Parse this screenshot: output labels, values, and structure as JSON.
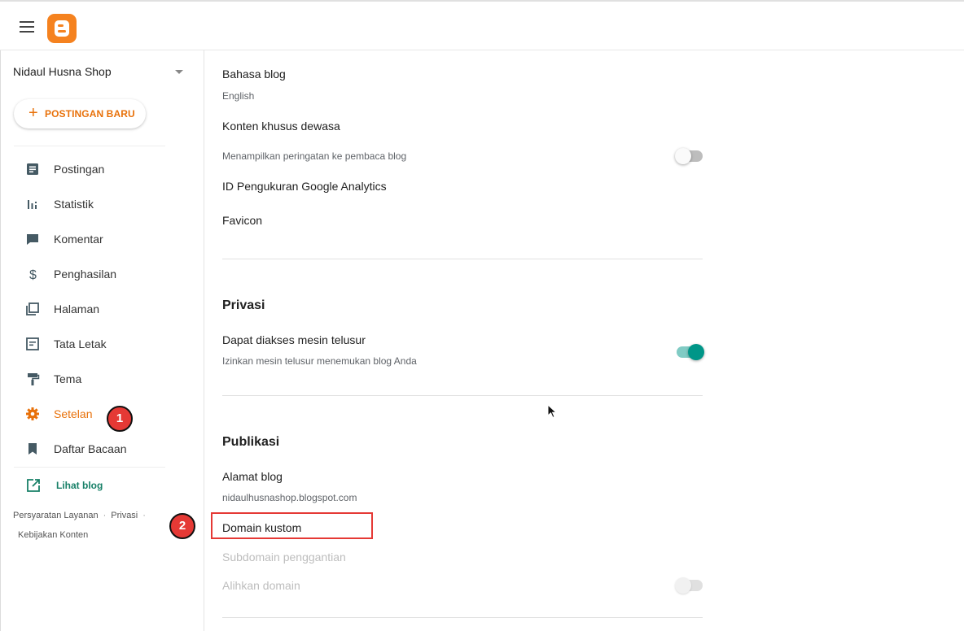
{
  "header": {
    "menu_icon": "hamburger-menu-icon",
    "logo": "blogger-logo"
  },
  "sidebar": {
    "blog_name": "Nidaul Husna Shop",
    "new_post_plus": "+",
    "new_post_label": "POSTINGAN BARU",
    "items": [
      {
        "label": "Postingan",
        "icon": "posts-icon"
      },
      {
        "label": "Statistik",
        "icon": "stats-icon"
      },
      {
        "label": "Komentar",
        "icon": "comment-icon"
      },
      {
        "label": "Penghasilan",
        "icon": "dollar-icon"
      },
      {
        "label": "Halaman",
        "icon": "pages-icon"
      },
      {
        "label": "Tata Letak",
        "icon": "layout-icon"
      },
      {
        "label": "Tema",
        "icon": "paint-roller-icon"
      },
      {
        "label": "Setelan",
        "icon": "gear-icon",
        "active": true
      },
      {
        "label": "Daftar Bacaan",
        "icon": "bookmark-icon"
      }
    ],
    "view_blog": "Lihat blog",
    "footer": {
      "terms": "Persyaratan Layanan",
      "privacy": "Privasi",
      "content_policy": "Kebijakan Konten"
    }
  },
  "settings": {
    "language": {
      "label": "Bahasa blog",
      "value": "English"
    },
    "adult": {
      "label": "Konten khusus dewasa",
      "desc": "Menampilkan peringatan ke pembaca blog",
      "enabled": false
    },
    "analytics": {
      "label": "ID Pengukuran Google Analytics"
    },
    "favicon": {
      "label": "Favicon"
    },
    "privacy": {
      "heading": "Privasi",
      "searchable": {
        "label": "Dapat diakses mesin telusur",
        "desc": "Izinkan mesin telusur menemukan blog Anda",
        "enabled": true
      }
    },
    "publishing": {
      "heading": "Publikasi",
      "address": {
        "label": "Alamat blog",
        "value": "nidaulhusnashop.blogspot.com"
      },
      "custom_domain": {
        "label": "Domain kustom"
      },
      "fallback_subdomain": {
        "label": "Subdomain penggantian"
      },
      "redirect_domain": {
        "label": "Alihkan domain",
        "enabled": false
      }
    }
  },
  "annotations": {
    "step1": "1",
    "step2": "2",
    "color": "#e53935"
  },
  "colors": {
    "accent": "#e8710a",
    "teal": "#009688",
    "link": "#188068"
  }
}
